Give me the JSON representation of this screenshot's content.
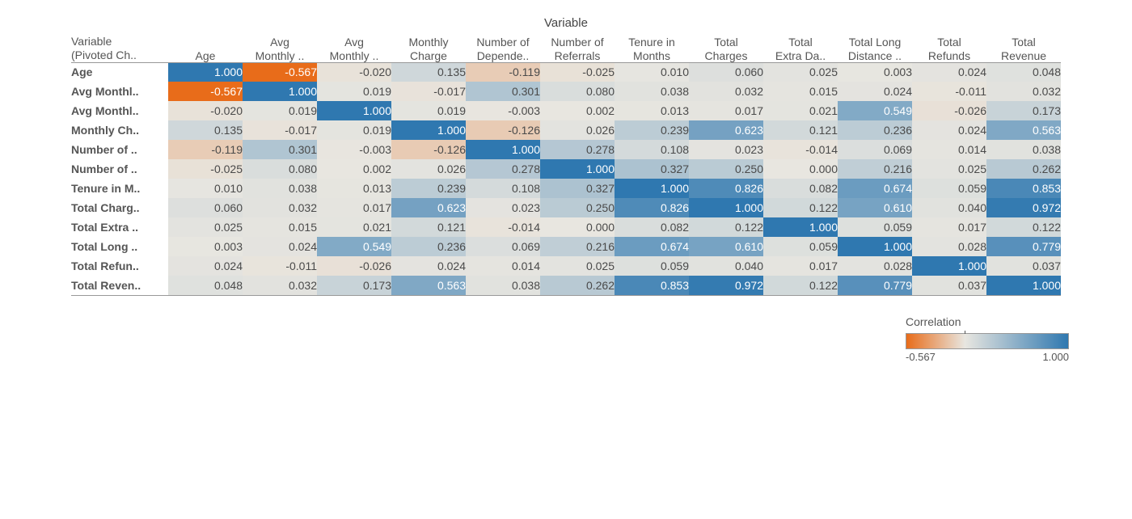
{
  "chart_data": {
    "type": "heatmap",
    "title": "Variable",
    "row_header_title": "Variable\n(Pivoted Ch..",
    "legend_title": "Correlation",
    "legend_min": "-0.567",
    "legend_max": "1.000",
    "color_min": "#e86c1a",
    "color_mid": "#e8e6e0",
    "color_max": "#2f78b0",
    "columns": [
      "Age",
      "Avg\nMonthly ..",
      "Avg\nMonthly ..",
      "Monthly\nCharge",
      "Number of\nDepende..",
      "Number of\nReferrals",
      "Tenure in\nMonths",
      "Total\nCharges",
      "Total\nExtra Da..",
      "Total Long\nDistance ..",
      "Total\nRefunds",
      "Total\nRevenue"
    ],
    "rows": [
      {
        "label": "Age",
        "values": [
          1.0,
          -0.567,
          -0.02,
          0.135,
          -0.119,
          -0.025,
          0.01,
          0.06,
          0.025,
          0.003,
          0.024,
          0.048
        ]
      },
      {
        "label": "Avg Monthl..",
        "values": [
          -0.567,
          1.0,
          0.019,
          -0.017,
          0.301,
          0.08,
          0.038,
          0.032,
          0.015,
          0.024,
          -0.011,
          0.032
        ]
      },
      {
        "label": "Avg Monthl..",
        "values": [
          -0.02,
          0.019,
          1.0,
          0.019,
          -0.003,
          0.002,
          0.013,
          0.017,
          0.021,
          0.549,
          -0.026,
          0.173
        ]
      },
      {
        "label": "Monthly Ch..",
        "values": [
          0.135,
          -0.017,
          0.019,
          1.0,
          -0.126,
          0.026,
          0.239,
          0.623,
          0.121,
          0.236,
          0.024,
          0.563
        ]
      },
      {
        "label": "Number of ..",
        "values": [
          -0.119,
          0.301,
          -0.003,
          -0.126,
          1.0,
          0.278,
          0.108,
          0.023,
          -0.014,
          0.069,
          0.014,
          0.038
        ]
      },
      {
        "label": "Number of ..",
        "values": [
          -0.025,
          0.08,
          0.002,
          0.026,
          0.278,
          1.0,
          0.327,
          0.25,
          0.0,
          0.216,
          0.025,
          0.262
        ]
      },
      {
        "label": "Tenure in M..",
        "values": [
          0.01,
          0.038,
          0.013,
          0.239,
          0.108,
          0.327,
          1.0,
          0.826,
          0.082,
          0.674,
          0.059,
          0.853
        ]
      },
      {
        "label": "Total Charg..",
        "values": [
          0.06,
          0.032,
          0.017,
          0.623,
          0.023,
          0.25,
          0.826,
          1.0,
          0.122,
          0.61,
          0.04,
          0.972
        ]
      },
      {
        "label": "Total Extra ..",
        "values": [
          0.025,
          0.015,
          0.021,
          0.121,
          -0.014,
          0.0,
          0.082,
          0.122,
          1.0,
          0.059,
          0.017,
          0.122
        ]
      },
      {
        "label": "Total Long ..",
        "values": [
          0.003,
          0.024,
          0.549,
          0.236,
          0.069,
          0.216,
          0.674,
          0.61,
          0.059,
          1.0,
          0.028,
          0.779
        ]
      },
      {
        "label": "Total Refun..",
        "values": [
          0.024,
          -0.011,
          -0.026,
          0.024,
          0.014,
          0.025,
          0.059,
          0.04,
          0.017,
          0.028,
          1.0,
          0.037
        ]
      },
      {
        "label": "Total Reven..",
        "values": [
          0.048,
          0.032,
          0.173,
          0.563,
          0.038,
          0.262,
          0.853,
          0.972,
          0.122,
          0.779,
          0.037,
          1.0
        ]
      }
    ]
  }
}
